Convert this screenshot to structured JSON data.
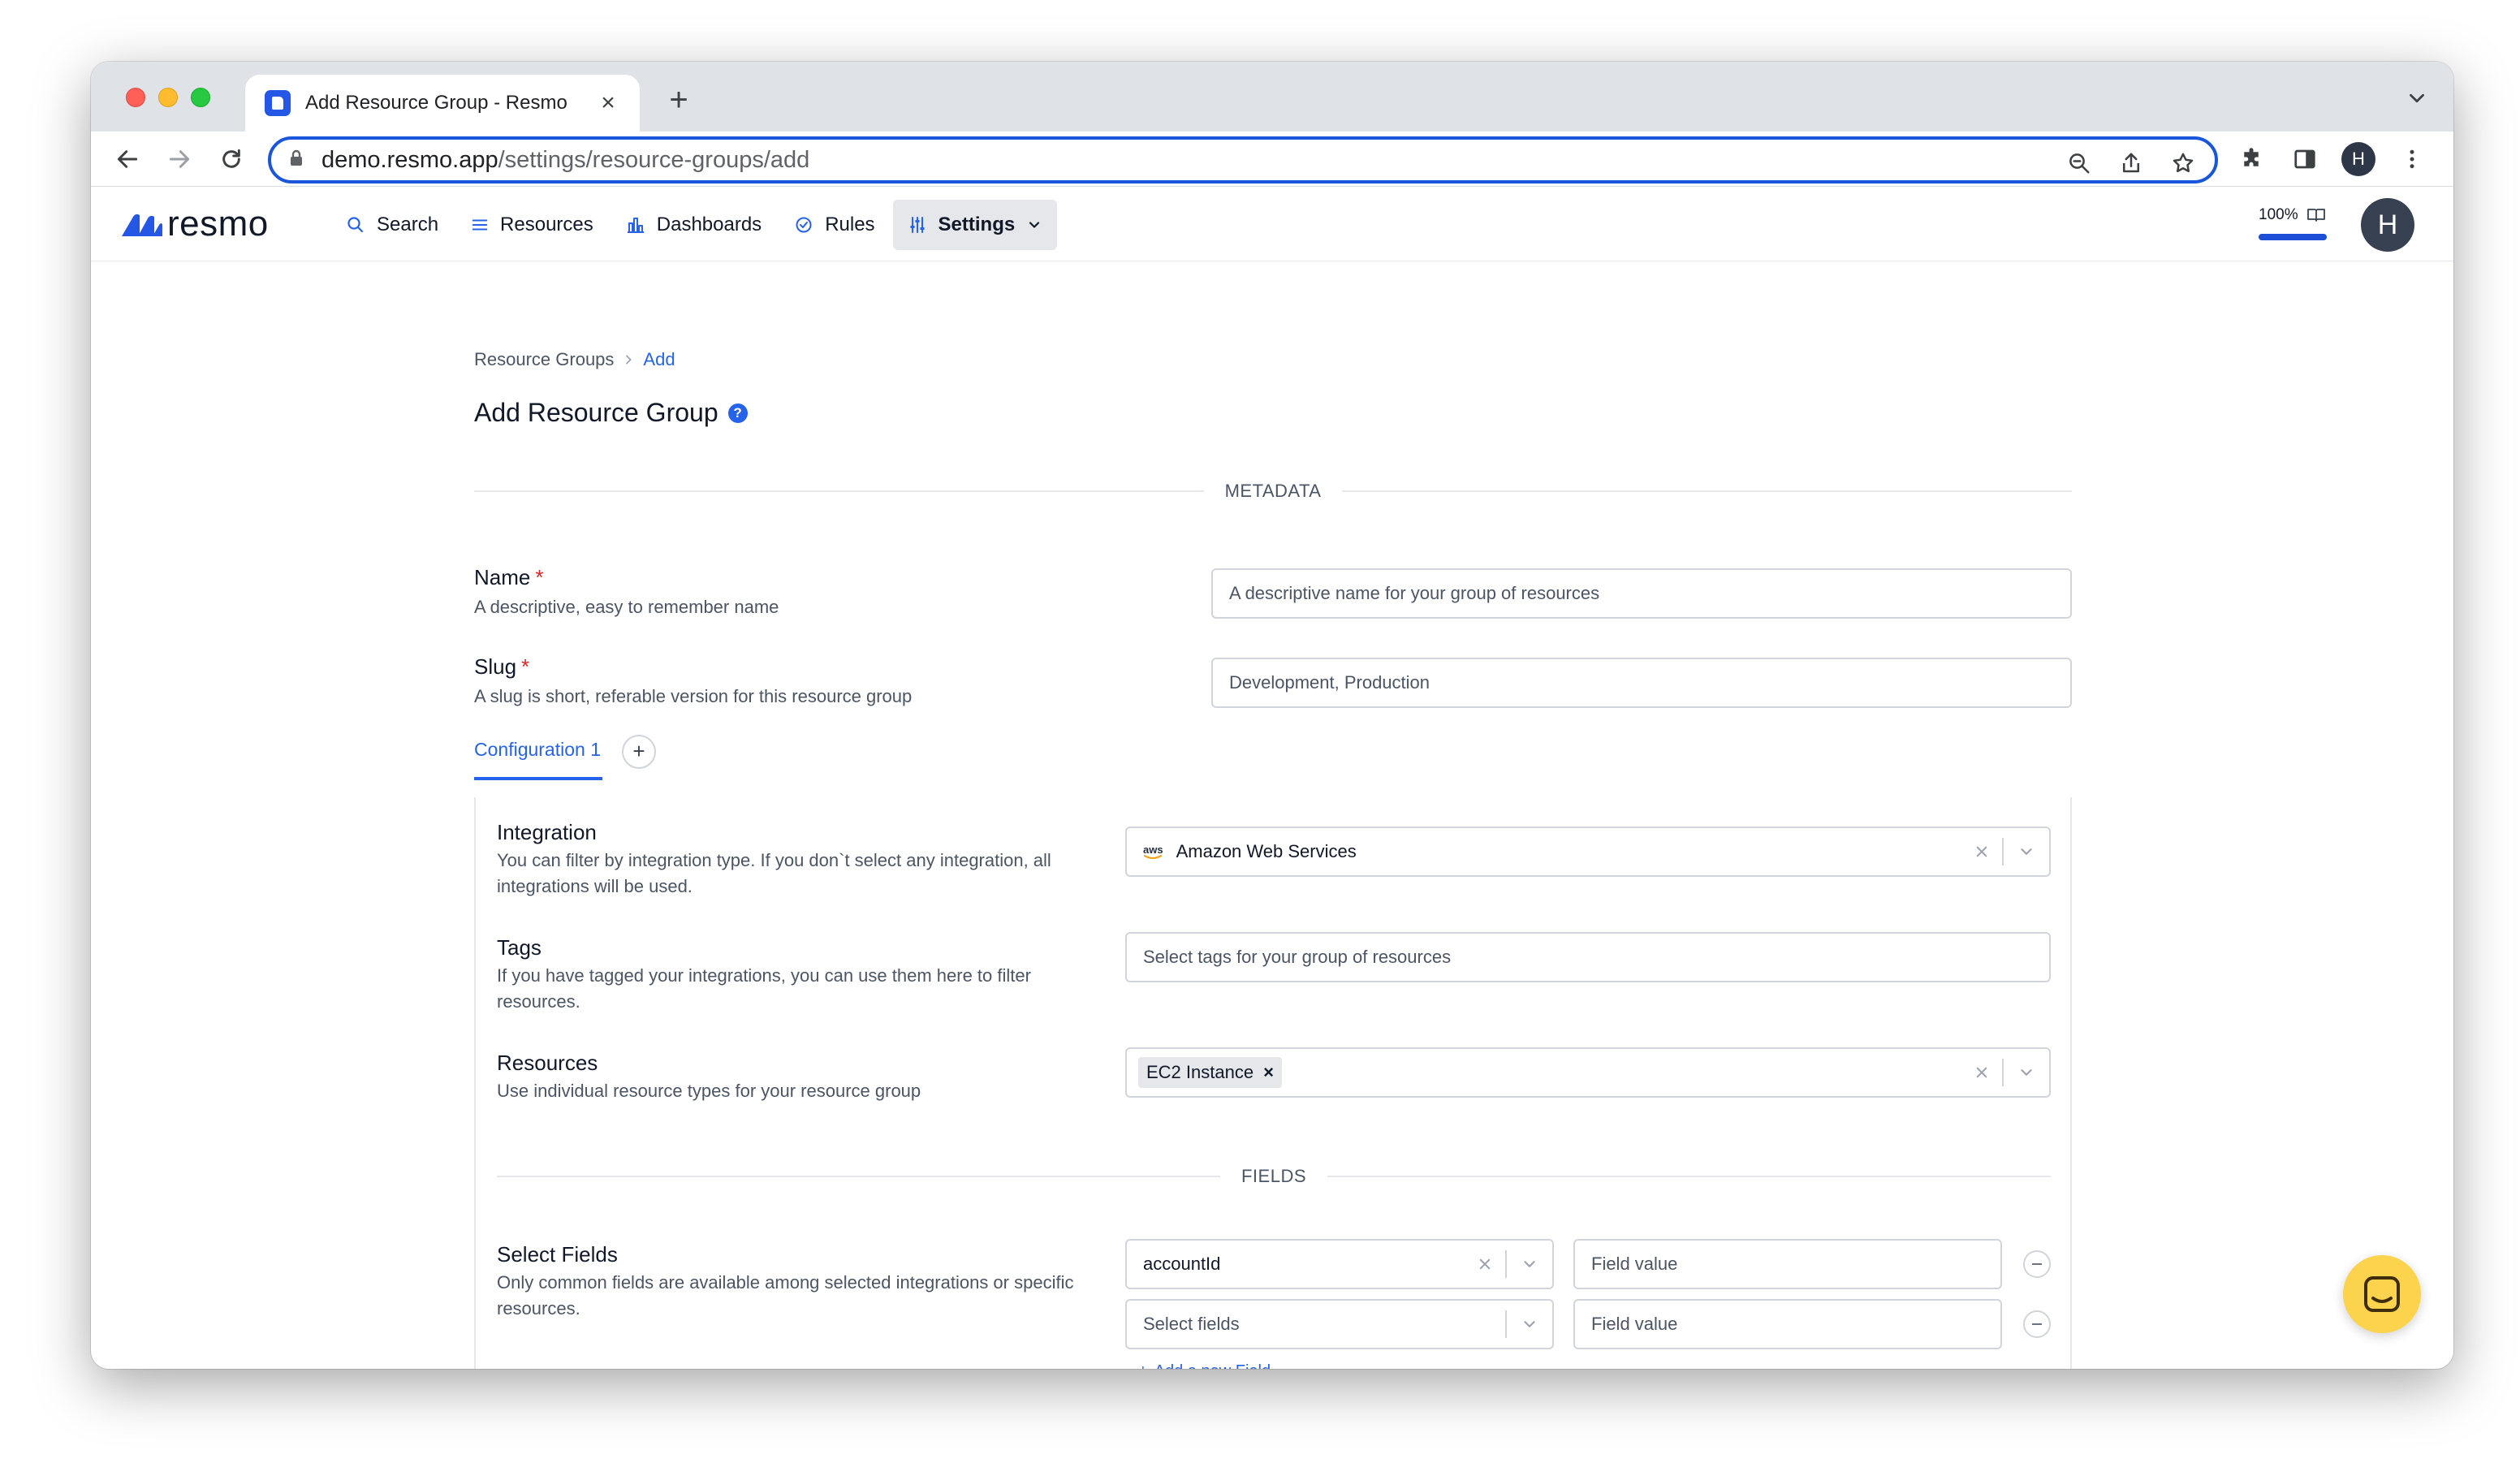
{
  "browser": {
    "tab_title": "Add Resource Group - Resmo",
    "tab_close": "×",
    "new_tab": "+",
    "url_host": "demo.resmo.app",
    "url_path": "/settings/resource-groups/add",
    "profile_initial": "H"
  },
  "app": {
    "logo_text": "resmo",
    "nav": [
      {
        "label": "Search",
        "icon": "search-icon"
      },
      {
        "label": "Resources",
        "icon": "list-icon"
      },
      {
        "label": "Dashboards",
        "icon": "bar-chart-icon"
      },
      {
        "label": "Rules",
        "icon": "check-circle-icon"
      },
      {
        "label": "Settings",
        "icon": "sliders-icon",
        "active": true
      }
    ],
    "zoom_label": "100%",
    "user_initial": "H",
    "accent_color": "#2563eb"
  },
  "page": {
    "breadcrumb_root": "Resource Groups",
    "breadcrumb_current": "Add",
    "title": "Add Resource Group",
    "help": "?"
  },
  "metadata": {
    "section_label": "METADATA",
    "name": {
      "label": "Name",
      "required": "*",
      "help": "A descriptive, easy to remember name",
      "placeholder": "A descriptive name for your group of resources"
    },
    "slug": {
      "label": "Slug",
      "required": "*",
      "help": "A slug is short, referable version for this resource group",
      "placeholder": "Development, Production"
    }
  },
  "configuration": {
    "tab_label": "Configuration 1",
    "add_label": "+",
    "integration": {
      "label": "Integration",
      "help": "You can filter by integration type. If you don`t select any integration, all integrations will be used.",
      "value": "Amazon Web Services",
      "icon_text": "aws"
    },
    "tags": {
      "label": "Tags",
      "help": "If you have tagged your integrations, you can use them here to filter resources.",
      "placeholder": "Select tags for your group of resources"
    },
    "resources": {
      "label": "Resources",
      "help": "Use individual resource types for your resource group",
      "chip": "EC2 Instance",
      "chip_remove": "×"
    },
    "fields_section_label": "FIELDS",
    "select_fields": {
      "label": "Select Fields",
      "help": "Only common fields are available among selected integrations or specific resources.",
      "rows": [
        {
          "field": "accountId",
          "value_placeholder": "Field value"
        },
        {
          "field_placeholder": "Select fields",
          "value_placeholder": "Field value"
        }
      ],
      "add_label": "Add a new Field",
      "add_plus": "+"
    }
  }
}
